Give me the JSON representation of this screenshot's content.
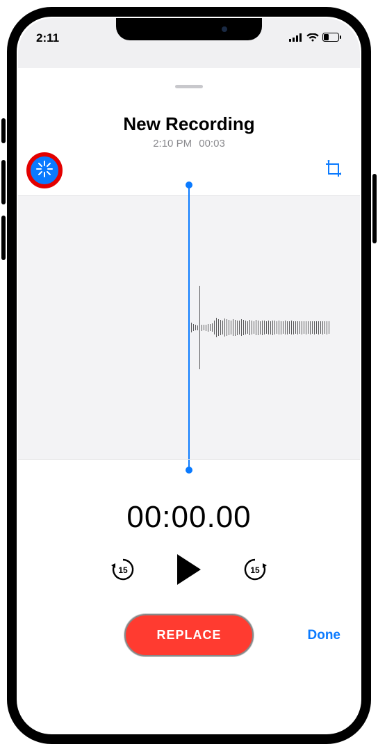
{
  "statusbar": {
    "time": "2:11",
    "signal_icon": "signal-icon",
    "wifi_icon": "wifi-icon",
    "battery_icon": "battery-icon"
  },
  "recording": {
    "title": "New Recording",
    "clock_time": "2:10 PM",
    "duration": "00:03"
  },
  "toolbar": {
    "enhance_icon": "enhance-sparkle-icon",
    "crop_icon": "crop-icon"
  },
  "playback": {
    "current_position": "00:00.00",
    "skip_back_label": "15",
    "skip_forward_label": "15"
  },
  "actions": {
    "replace_label": "REPLACE",
    "done_label": "Done"
  },
  "colors": {
    "accent": "#0a7aff",
    "destructive": "#ff3b30",
    "annotation_ring": "#e30000"
  },
  "waveform_heights": [
    34,
    14,
    10,
    8,
    7,
    120,
    9,
    8,
    9,
    11,
    10,
    12,
    20,
    28,
    24,
    22,
    20,
    26,
    24,
    22,
    20,
    24,
    23,
    21,
    20,
    24,
    22,
    20,
    18,
    22,
    20,
    18,
    22,
    21,
    19,
    21,
    20,
    18,
    20,
    19,
    21,
    20,
    18,
    20,
    19,
    18,
    20,
    19,
    18,
    20,
    19,
    18,
    19,
    18,
    19,
    18,
    19,
    18,
    19,
    18,
    19,
    18,
    19,
    18,
    19,
    18,
    19,
    18
  ]
}
